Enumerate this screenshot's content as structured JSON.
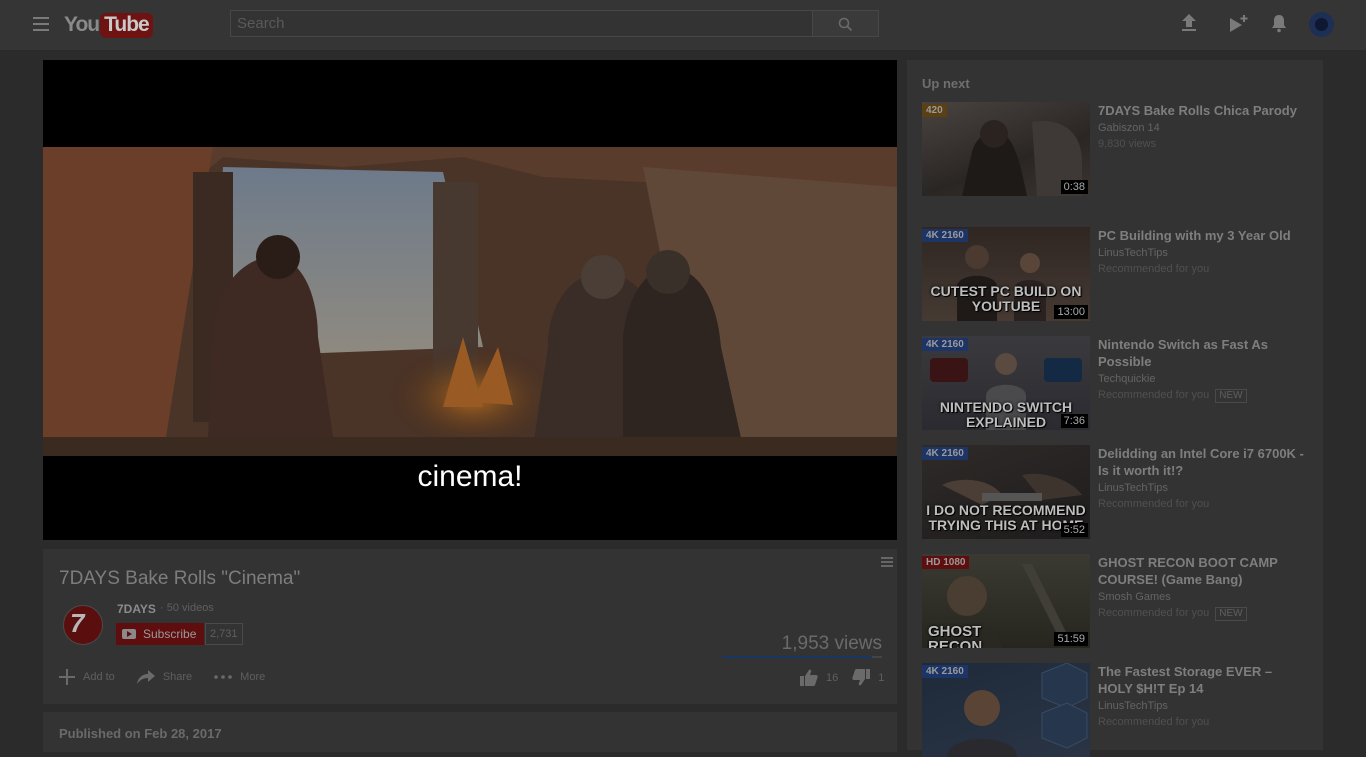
{
  "header": {
    "logo_you": "You",
    "logo_tube": "Tube",
    "search_placeholder": "Search"
  },
  "player": {
    "caption": "cinema!"
  },
  "video": {
    "title": "7DAYS Bake Rolls \"Cinema\"",
    "channel": "7DAYS",
    "channel_videos": "· 50 videos",
    "subscribe_label": "Subscribe",
    "subscriber_count": "2,731",
    "views": "1,953 views",
    "like_ratio": 0.94,
    "actions": {
      "add_to": "Add to",
      "share": "Share",
      "more": "More"
    },
    "likes": "16",
    "dislikes": "1",
    "published": "Published on Feb 28, 2017"
  },
  "sidebar": {
    "up_next_label": "Up next",
    "items": [
      {
        "title": "7DAYS Bake Rolls Chica Parody",
        "channel": "Gabiszon 14",
        "meta": "9,830 views",
        "badge": "420",
        "duration": "0:38",
        "thumb_text": "",
        "is_new": false
      },
      {
        "title": "PC Building with my 3 Year Old",
        "channel": "LinusTechTips",
        "meta": "Recommended for you",
        "badge": "4K 2160",
        "duration": "13:00",
        "thumb_text": "CUTEST PC BUILD ON YOUTUBE",
        "is_new": false
      },
      {
        "title": "Nintendo Switch as Fast As Possible",
        "channel": "Techquickie",
        "meta": "Recommended for you",
        "badge": "4K 2160",
        "duration": "7:36",
        "thumb_text": "NINTENDO SWITCH EXPLAINED",
        "is_new": true
      },
      {
        "title": "Delidding an Intel Core i7 6700K - Is it worth it!?",
        "channel": "LinusTechTips",
        "meta": "Recommended for you",
        "badge": "4K 2160",
        "duration": "5:52",
        "thumb_text": "I DO NOT RECOMMEND TRYING THIS AT HOME",
        "is_new": false
      },
      {
        "title": "GHOST RECON BOOT CAMP COURSE! (Game Bang)",
        "channel": "Smosh Games",
        "meta": "Recommended for you",
        "badge": "HD 1080",
        "duration": "51:59",
        "thumb_text": "GHOST RECON",
        "is_new": true
      },
      {
        "title": "The Fastest Storage EVER – HOLY $H!T Ep 14",
        "channel": "LinusTechTips",
        "meta": "Recommended for you",
        "badge": "4K 2160",
        "duration": "",
        "thumb_text": "",
        "is_new": false
      }
    ],
    "new_label": "NEW"
  },
  "colors": {
    "badge_4k": "#1d3466",
    "badge_hd": "#5e0e0e",
    "badge_orange": "#5a4014"
  }
}
